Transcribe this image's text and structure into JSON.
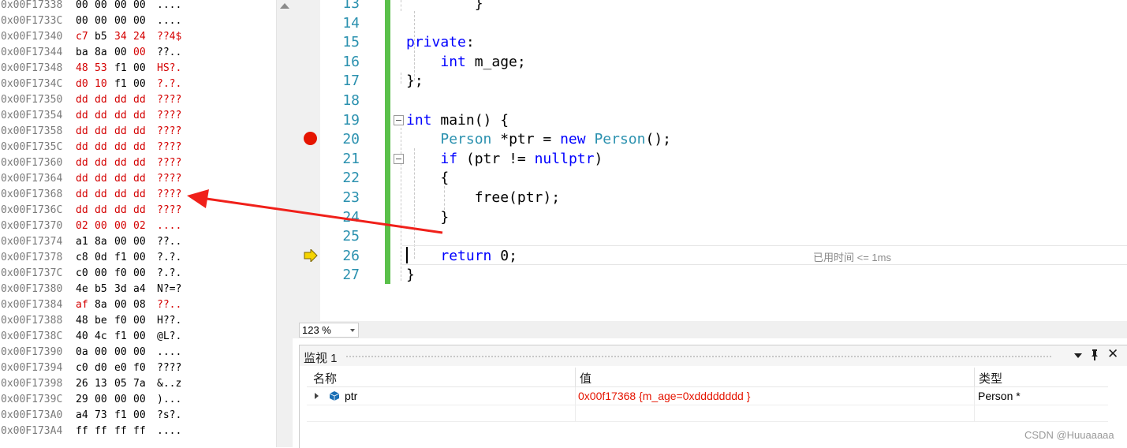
{
  "memory": {
    "rows": [
      {
        "addr": "0x00F17338",
        "bytes": [
          "00",
          "00",
          "00",
          "00"
        ],
        "ascii": "....",
        "changed": [
          false,
          false,
          false,
          false
        ],
        "ascii_changed": false
      },
      {
        "addr": "0x00F1733C",
        "bytes": [
          "00",
          "00",
          "00",
          "00"
        ],
        "ascii": "....",
        "changed": [
          false,
          false,
          false,
          false
        ],
        "ascii_changed": false
      },
      {
        "addr": "0x00F17340",
        "bytes": [
          "c7",
          "b5",
          "34",
          "24"
        ],
        "ascii": "??4$",
        "changed": [
          true,
          false,
          true,
          true
        ],
        "ascii_changed": true
      },
      {
        "addr": "0x00F17344",
        "bytes": [
          "ba",
          "8a",
          "00",
          "00"
        ],
        "ascii": "??..",
        "changed": [
          false,
          false,
          false,
          true
        ],
        "ascii_changed": false
      },
      {
        "addr": "0x00F17348",
        "bytes": [
          "48",
          "53",
          "f1",
          "00"
        ],
        "ascii": "HS?.",
        "changed": [
          true,
          true,
          false,
          false
        ],
        "ascii_changed": true
      },
      {
        "addr": "0x00F1734C",
        "bytes": [
          "d0",
          "10",
          "f1",
          "00"
        ],
        "ascii": "?.?.",
        "changed": [
          true,
          true,
          false,
          false
        ],
        "ascii_changed": true
      },
      {
        "addr": "0x00F17350",
        "bytes": [
          "dd",
          "dd",
          "dd",
          "dd"
        ],
        "ascii": "????",
        "changed": [
          true,
          true,
          true,
          true
        ],
        "ascii_changed": true
      },
      {
        "addr": "0x00F17354",
        "bytes": [
          "dd",
          "dd",
          "dd",
          "dd"
        ],
        "ascii": "????",
        "changed": [
          true,
          true,
          true,
          true
        ],
        "ascii_changed": true
      },
      {
        "addr": "0x00F17358",
        "bytes": [
          "dd",
          "dd",
          "dd",
          "dd"
        ],
        "ascii": "????",
        "changed": [
          true,
          true,
          true,
          true
        ],
        "ascii_changed": true
      },
      {
        "addr": "0x00F1735C",
        "bytes": [
          "dd",
          "dd",
          "dd",
          "dd"
        ],
        "ascii": "????",
        "changed": [
          true,
          true,
          true,
          true
        ],
        "ascii_changed": true
      },
      {
        "addr": "0x00F17360",
        "bytes": [
          "dd",
          "dd",
          "dd",
          "dd"
        ],
        "ascii": "????",
        "changed": [
          true,
          true,
          true,
          true
        ],
        "ascii_changed": true
      },
      {
        "addr": "0x00F17364",
        "bytes": [
          "dd",
          "dd",
          "dd",
          "dd"
        ],
        "ascii": "????",
        "changed": [
          true,
          true,
          true,
          true
        ],
        "ascii_changed": true
      },
      {
        "addr": "0x00F17368",
        "bytes": [
          "dd",
          "dd",
          "dd",
          "dd"
        ],
        "ascii": "????",
        "changed": [
          true,
          true,
          true,
          true
        ],
        "ascii_changed": true
      },
      {
        "addr": "0x00F1736C",
        "bytes": [
          "dd",
          "dd",
          "dd",
          "dd"
        ],
        "ascii": "????",
        "changed": [
          true,
          true,
          true,
          true
        ],
        "ascii_changed": true
      },
      {
        "addr": "0x00F17370",
        "bytes": [
          "02",
          "00",
          "00",
          "02"
        ],
        "ascii": "....",
        "changed": [
          true,
          true,
          true,
          true
        ],
        "ascii_changed": true
      },
      {
        "addr": "0x00F17374",
        "bytes": [
          "a1",
          "8a",
          "00",
          "00"
        ],
        "ascii": "??..",
        "changed": [
          false,
          false,
          false,
          false
        ],
        "ascii_changed": false
      },
      {
        "addr": "0x00F17378",
        "bytes": [
          "c8",
          "0d",
          "f1",
          "00"
        ],
        "ascii": "?.?.",
        "changed": [
          false,
          false,
          false,
          false
        ],
        "ascii_changed": false
      },
      {
        "addr": "0x00F1737C",
        "bytes": [
          "c0",
          "00",
          "f0",
          "00"
        ],
        "ascii": "?.?.",
        "changed": [
          false,
          false,
          false,
          false
        ],
        "ascii_changed": false
      },
      {
        "addr": "0x00F17380",
        "bytes": [
          "4e",
          "b5",
          "3d",
          "a4"
        ],
        "ascii": "N?=?",
        "changed": [
          false,
          false,
          false,
          false
        ],
        "ascii_changed": false
      },
      {
        "addr": "0x00F17384",
        "bytes": [
          "af",
          "8a",
          "00",
          "08"
        ],
        "ascii": "??..",
        "changed": [
          true,
          false,
          false,
          false
        ],
        "ascii_changed": true
      },
      {
        "addr": "0x00F17388",
        "bytes": [
          "48",
          "be",
          "f0",
          "00"
        ],
        "ascii": "H??.",
        "changed": [
          false,
          false,
          false,
          false
        ],
        "ascii_changed": false
      },
      {
        "addr": "0x00F1738C",
        "bytes": [
          "40",
          "4c",
          "f1",
          "00"
        ],
        "ascii": "@L?.",
        "changed": [
          false,
          false,
          false,
          false
        ],
        "ascii_changed": false
      },
      {
        "addr": "0x00F17390",
        "bytes": [
          "0a",
          "00",
          "00",
          "00"
        ],
        "ascii": "....",
        "changed": [
          false,
          false,
          false,
          false
        ],
        "ascii_changed": false
      },
      {
        "addr": "0x00F17394",
        "bytes": [
          "c0",
          "d0",
          "e0",
          "f0"
        ],
        "ascii": "????",
        "changed": [
          false,
          false,
          false,
          false
        ],
        "ascii_changed": false
      },
      {
        "addr": "0x00F17398",
        "bytes": [
          "26",
          "13",
          "05",
          "7a"
        ],
        "ascii": "&..z",
        "changed": [
          false,
          false,
          false,
          false
        ],
        "ascii_changed": false
      },
      {
        "addr": "0x00F1739C",
        "bytes": [
          "29",
          "00",
          "00",
          "00"
        ],
        "ascii": ")...",
        "changed": [
          false,
          false,
          false,
          false
        ],
        "ascii_changed": false
      },
      {
        "addr": "0x00F173A0",
        "bytes": [
          "a4",
          "73",
          "f1",
          "00"
        ],
        "ascii": "?s?.",
        "changed": [
          false,
          false,
          false,
          false
        ],
        "ascii_changed": false
      },
      {
        "addr": "0x00F173A4",
        "bytes": [
          "ff",
          "ff",
          "ff",
          "ff"
        ],
        "ascii": "....",
        "changed": [
          false,
          false,
          false,
          false
        ],
        "ascii_changed": false
      }
    ]
  },
  "editor": {
    "lines": [
      {
        "num": "13",
        "code": [
          {
            "t": "        }",
            "c": ""
          }
        ]
      },
      {
        "num": "14",
        "code": []
      },
      {
        "num": "15",
        "code": [
          {
            "t": "private",
            "c": "kw"
          },
          {
            "t": ":",
            "c": ""
          }
        ]
      },
      {
        "num": "16",
        "code": [
          {
            "t": "    ",
            "c": ""
          },
          {
            "t": "int",
            "c": "kw"
          },
          {
            "t": " m_age;",
            "c": ""
          }
        ]
      },
      {
        "num": "17",
        "code": [
          {
            "t": "};",
            "c": ""
          }
        ]
      },
      {
        "num": "18",
        "code": []
      },
      {
        "num": "19",
        "code": [
          {
            "t": "int",
            "c": "kw"
          },
          {
            "t": " main() {",
            "c": ""
          }
        ]
      },
      {
        "num": "20",
        "code": [
          {
            "t": "    ",
            "c": ""
          },
          {
            "t": "Person",
            "c": "ty"
          },
          {
            "t": " *ptr = ",
            "c": ""
          },
          {
            "t": "new",
            "c": "kw"
          },
          {
            "t": " ",
            "c": ""
          },
          {
            "t": "Person",
            "c": "ty"
          },
          {
            "t": "();",
            "c": ""
          }
        ]
      },
      {
        "num": "21",
        "code": [
          {
            "t": "    ",
            "c": ""
          },
          {
            "t": "if",
            "c": "kw"
          },
          {
            "t": " (ptr != ",
            "c": ""
          },
          {
            "t": "nullptr",
            "c": "kw"
          },
          {
            "t": ")",
            "c": ""
          }
        ]
      },
      {
        "num": "22",
        "code": [
          {
            "t": "    {",
            "c": ""
          }
        ]
      },
      {
        "num": "23",
        "code": [
          {
            "t": "        free(ptr);",
            "c": ""
          }
        ]
      },
      {
        "num": "24",
        "code": [
          {
            "t": "    }",
            "c": ""
          }
        ]
      },
      {
        "num": "25",
        "code": []
      },
      {
        "num": "26",
        "code": [
          {
            "t": "    ",
            "c": ""
          },
          {
            "t": "return",
            "c": "kw"
          },
          {
            "t": " 0;",
            "c": ""
          }
        ]
      },
      {
        "num": "27",
        "code": [
          {
            "t": "}",
            "c": ""
          }
        ]
      }
    ],
    "perf_tip": "已用时间 <= 1ms",
    "zoom": "123 %"
  },
  "watch": {
    "title": "监视 1",
    "columns": {
      "name": "名称",
      "value": "值",
      "type": "类型"
    },
    "rows": [
      {
        "name": "ptr",
        "value": "0x00f17368 {m_age=0xdddddddd }",
        "type": "Person *"
      }
    ],
    "colors": {
      "changed_value": "#e51400"
    }
  },
  "watermark": "CSDN @Huuaaaaa",
  "colors": {
    "keyword": "#0000ff",
    "type": "#2b91af",
    "line_number": "#2b91af",
    "changed_memory": "#d40000",
    "breakpoint": "#e51400",
    "arrow": "#f0201a",
    "change_bar": "#5ac04a"
  },
  "icons": {
    "breakpoint": "breakpoint-icon",
    "execution_pointer": "arrow-right-icon",
    "expander": "triangle-right-icon",
    "field": "cube-icon",
    "pin": "pin-icon",
    "close": "close-icon",
    "dropdown": "chevron-down-icon"
  }
}
